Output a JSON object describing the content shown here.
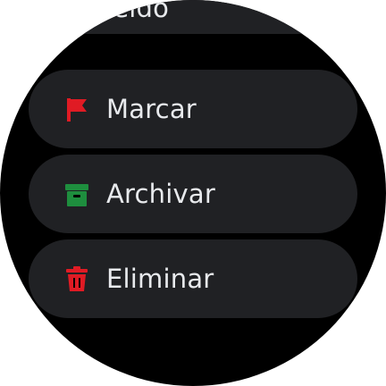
{
  "partial_item": {
    "label": "leído"
  },
  "actions": [
    {
      "label": "Marcar",
      "icon": "flag-icon",
      "color": "#e01b24"
    },
    {
      "label": "Archivar",
      "icon": "archive-icon",
      "color": "#1e8e3e"
    },
    {
      "label": "Eliminar",
      "icon": "trash-icon",
      "color": "#e01b24"
    }
  ]
}
